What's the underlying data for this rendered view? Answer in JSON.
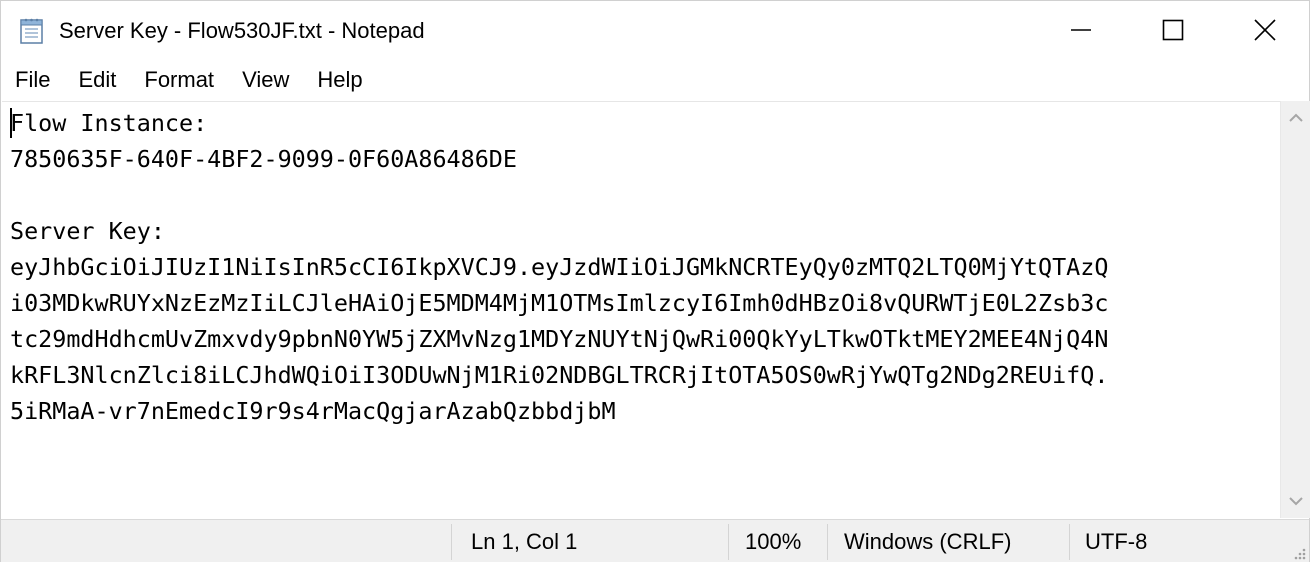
{
  "window": {
    "title": "Server Key - Flow530JF.txt - Notepad",
    "icon": "notepad-icon"
  },
  "caption_buttons": {
    "minimize_icon": "minimize-icon",
    "maximize_icon": "maximize-icon",
    "close_icon": "close-icon"
  },
  "menu": {
    "items": [
      "File",
      "Edit",
      "Format",
      "View",
      "Help"
    ]
  },
  "editor": {
    "content": "Flow Instance:\n7850635F-640F-4BF2-9099-0F60A86486DE\n\nServer Key:\neyJhbGciOiJIUzI1NiIsInR5cCI6IkpXVCJ9.eyJzdWIiOiJGMkNCRTEyQy0zMTQ2LTQ0MjYtQTAzQ\ni03MDkwRUYxNzEzMzIiLCJleHAiOjE5MDM4MjM1OTMsImlzcyI6Imh0dHBzOi8vQURWTjE0L2Zsb3c\ntc29mdHdhcmUvZmxvdy9pbnN0YW5jZXMvNzg1MDYzNUYtNjQwRi00QkYyLTkwOTktMEY2MEE4NjQ4N\nkRFL3NlcnZlci8iLCJhdWQiOiI3ODUwNjM1Ri02NDBGLTRCRjItOTA5OS0wRjYwQTg2NDg2REUifQ.\n5iRMaA-vr7nEmedcI9r9s4rMacQgjarAzabQzbbdjbM"
  },
  "status": {
    "position": "Ln 1, Col 1",
    "zoom": "100%",
    "line_ending": "Windows (CRLF)",
    "encoding": "UTF-8"
  }
}
